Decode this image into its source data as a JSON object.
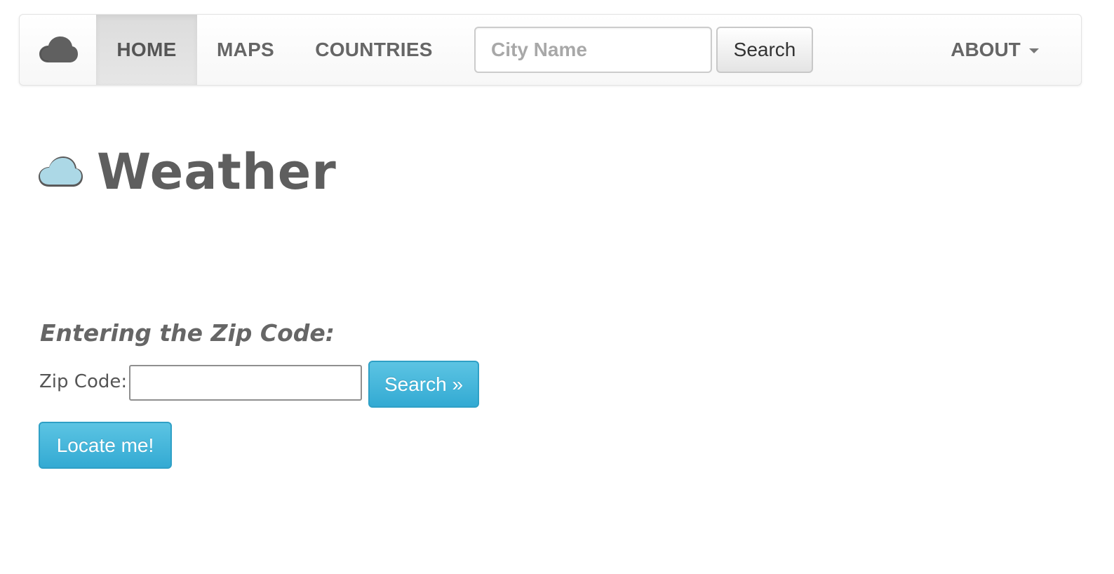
{
  "navbar": {
    "brand_icon": "cloud-icon",
    "brand_icon_color": "#606060",
    "items": [
      {
        "label": "HOME",
        "active": true
      },
      {
        "label": "MAPS",
        "active": false
      },
      {
        "label": "COUNTRIES",
        "active": false
      }
    ],
    "city_search": {
      "placeholder": "City Name",
      "value": "",
      "button_label": "Search"
    },
    "about": {
      "label": "ABOUT",
      "icon": "caret-down-icon"
    }
  },
  "header": {
    "icon": "cloud-icon",
    "icon_color": "#acd8e6",
    "title": "Weather"
  },
  "zip_section": {
    "heading": "Entering the Zip Code:",
    "label": "Zip Code:",
    "input_value": "",
    "search_button": "Search »",
    "locate_button": "Locate me!"
  },
  "colors": {
    "info_button": "#39b3d7",
    "text_muted": "#666666"
  }
}
